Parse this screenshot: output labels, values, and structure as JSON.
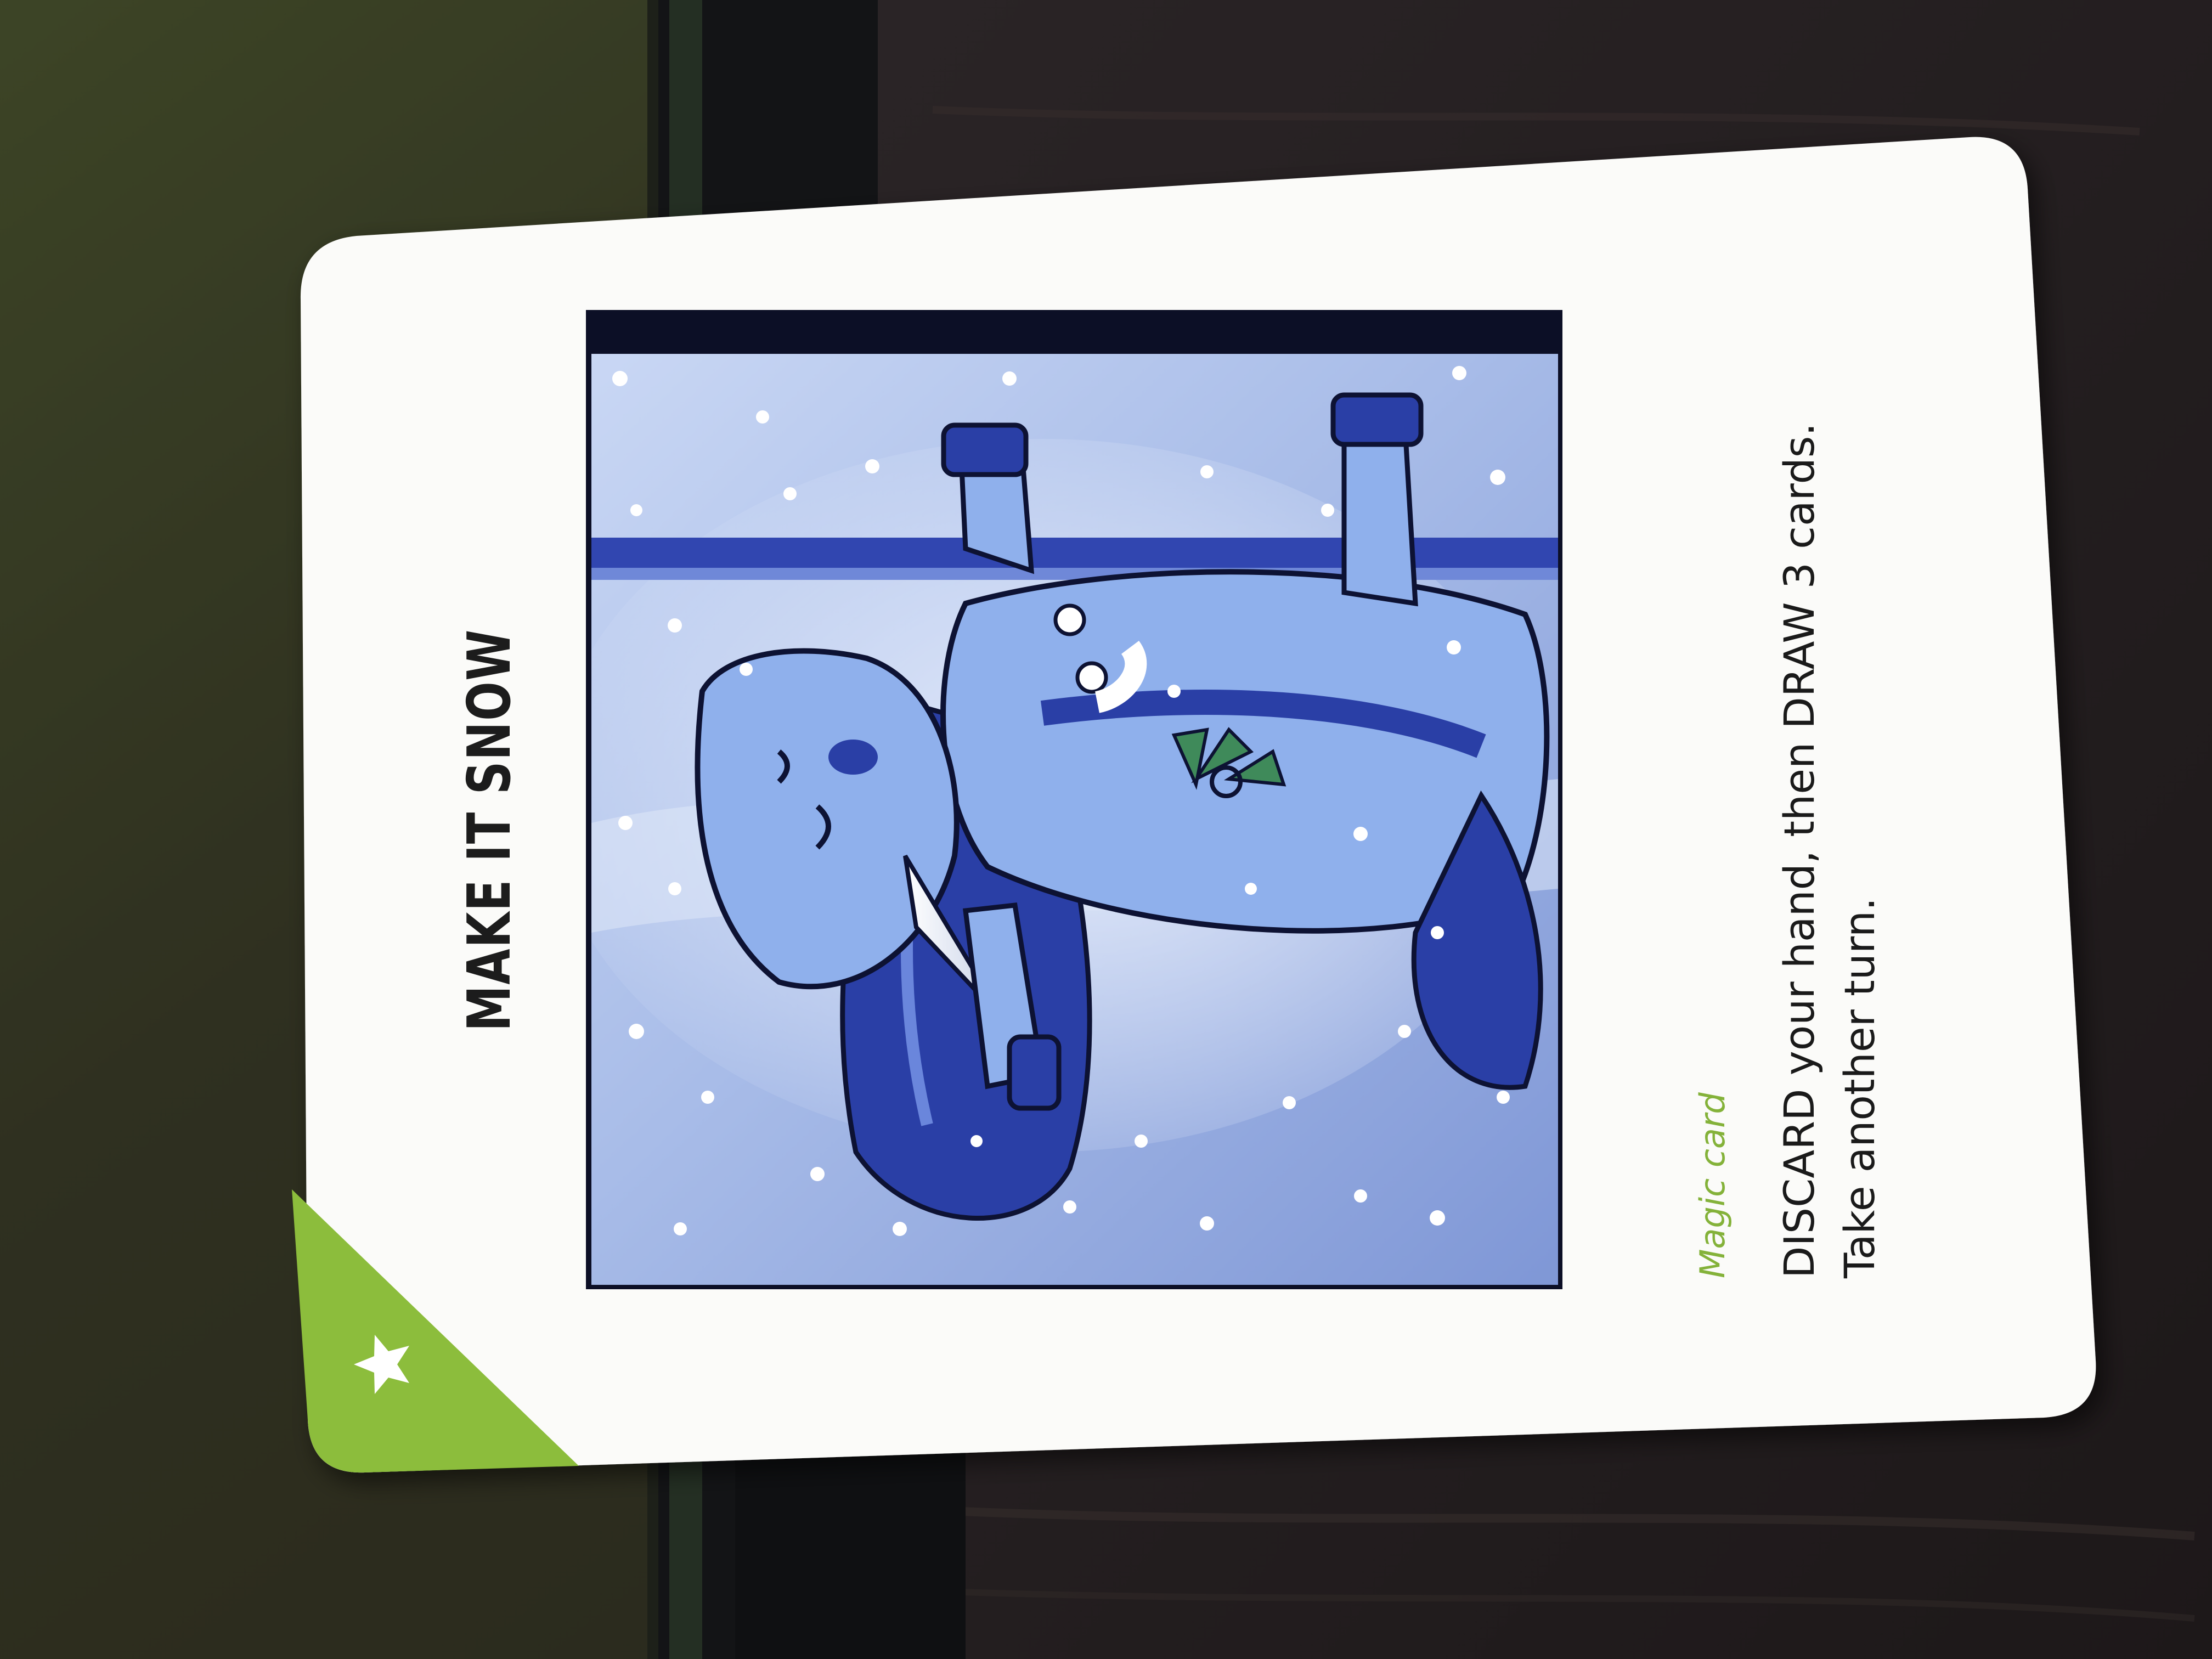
{
  "card": {
    "title": "MAKE IT SNOW",
    "type_label": "Magic card",
    "rule_lines": [
      "DISCARD your hand, then DRAW 3 cards.",
      "Take another turn."
    ],
    "corner_icon": "star-icon"
  },
  "colors": {
    "card_face": "#fbfbf9",
    "corner_accent": "#8cbd3c",
    "type_label": "#84b23a",
    "art_sky_light": "#dfe8f8",
    "art_sky_mid": "#9eb3e3",
    "art_unicorn_light": "#8fb0ec",
    "art_unicorn_dark": "#2a3fa6",
    "art_outline": "#0d1233",
    "table_dark": "#1e1a18",
    "table_olive": "#3c4424"
  }
}
